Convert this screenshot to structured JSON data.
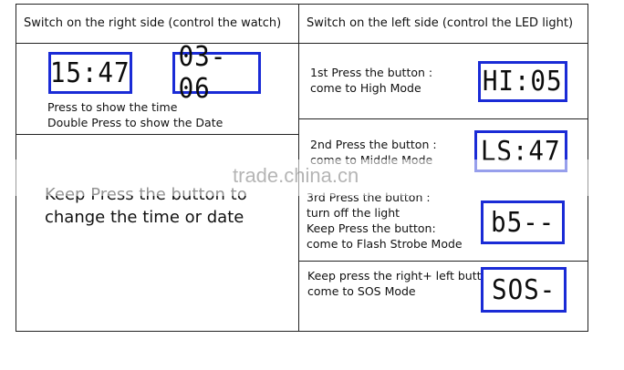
{
  "headers": {
    "right_side": "Switch on the right side (control the watch)",
    "left_side": "Switch on the left side (control the LED light)"
  },
  "watch": {
    "time_display": "15:47",
    "date_display": "03-06",
    "instructions": [
      "Press to show the time",
      "Double Press to show the Date"
    ],
    "keep_press_line1": "Keep Press the button to",
    "keep_press_line2": "change the time or date"
  },
  "led": {
    "mode1": {
      "lines": [
        "1st Press the button :",
        "come to High Mode"
      ],
      "display": "HI:05"
    },
    "mode2": {
      "lines": [
        "2nd Press the button :",
        "come to Middle Mode"
      ],
      "display": "LS:47"
    },
    "mode3": {
      "lines": [
        "3rd Press the button :",
        "turn off the light",
        "Keep Press the button:",
        "come to Flash Strobe Mode"
      ],
      "display": "b5--"
    },
    "mode4": {
      "lines": [
        "Keep press the right+ left button :",
        "come to SOS Mode"
      ],
      "display": "SOS-"
    }
  },
  "watermark": "trade.china.cn",
  "colors": {
    "lcd_border": "#1a2bd6",
    "grid": "#222222"
  }
}
